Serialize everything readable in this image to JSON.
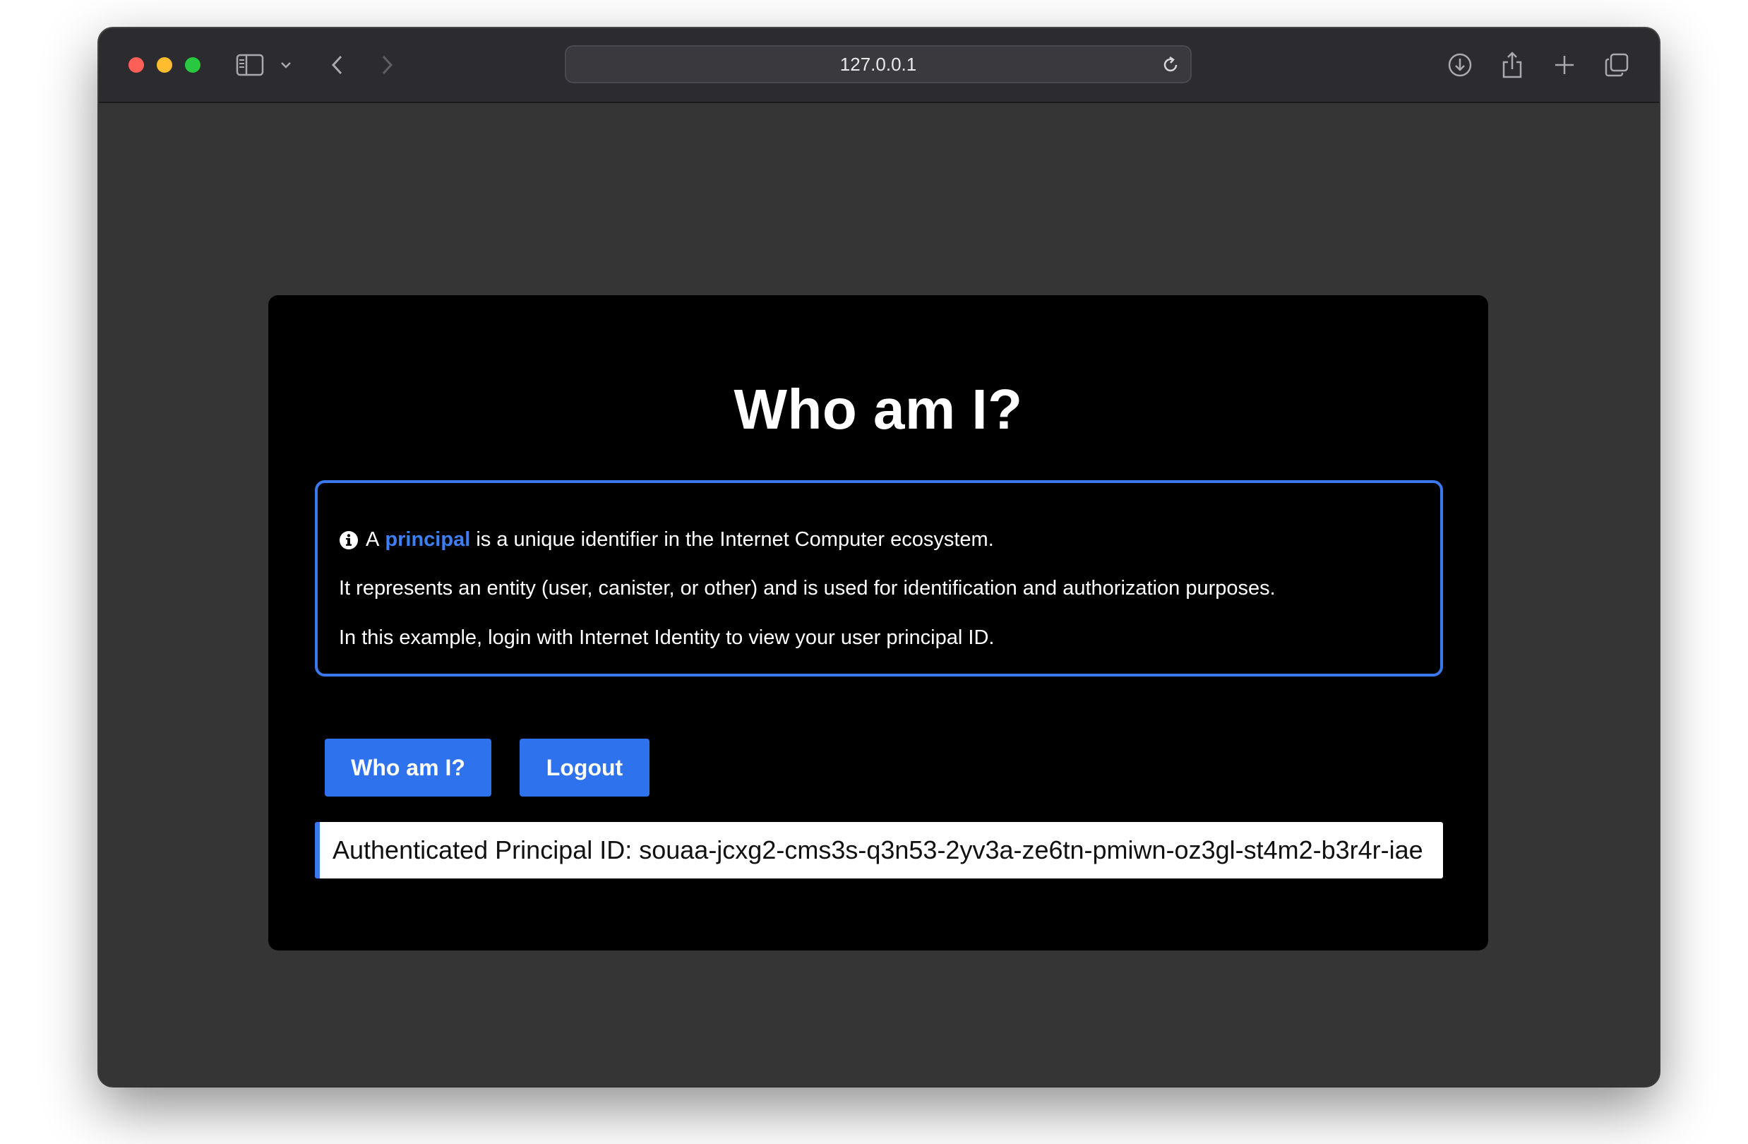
{
  "browser": {
    "url": "127.0.0.1",
    "icons": {
      "sidebar": "sidebar-icon",
      "chevron": "chevron-down-icon",
      "back": "back-arrow-icon",
      "forward": "forward-arrow-icon",
      "reload": "reload-icon",
      "download": "download-icon",
      "share": "share-icon",
      "new_tab": "plus-icon",
      "tabs": "tab-overview-icon"
    },
    "traffic_colors": {
      "close": "#ff5f57",
      "minimize": "#febc2e",
      "zoom": "#28c840"
    }
  },
  "page": {
    "title": "Who am I?",
    "info": {
      "line1_prefix": "A",
      "line1_link": "principal",
      "line1_suffix": "is a unique identifier in the Internet Computer ecosystem.",
      "line2": "It represents an entity (user, canister, or other) and is used for identification and authorization purposes.",
      "line3": "In this example, login with Internet Identity to view your user principal ID."
    },
    "buttons": {
      "whoami": "Who am I?",
      "logout": "Logout"
    },
    "result": "Authenticated Principal ID: souaa-jcxg2-cms3s-q3n53-2yv3a-ze6tn-pmiwn-oz3gl-st4m2-b3r4r-iae"
  },
  "colors": {
    "accent": "#2f72ed",
    "card": "#000000",
    "background": "#353535"
  }
}
